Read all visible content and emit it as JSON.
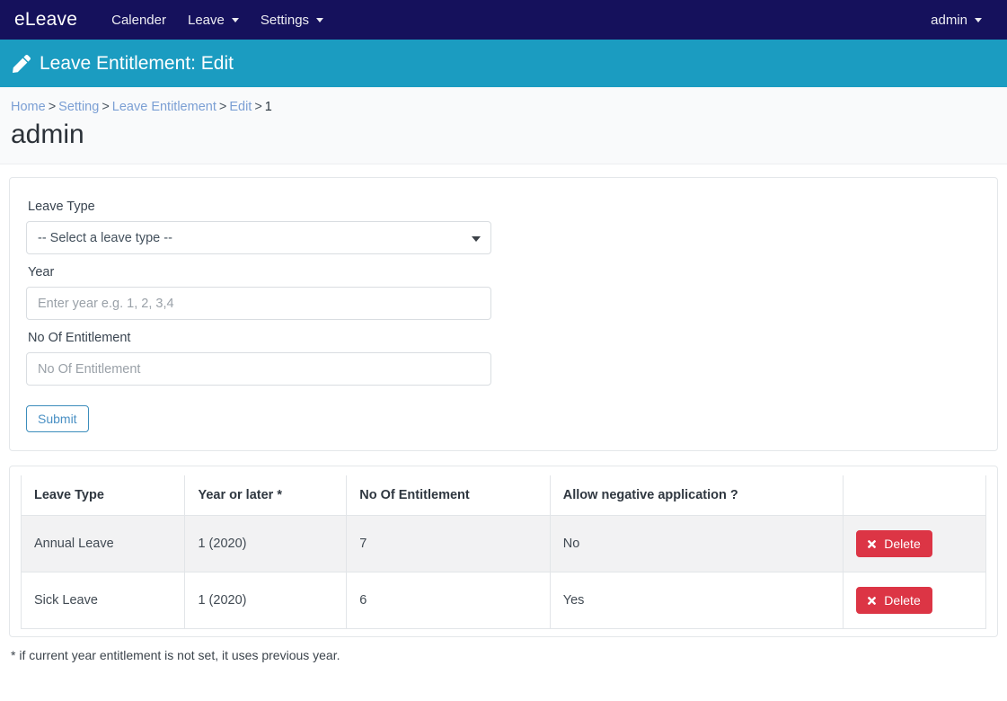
{
  "navbar": {
    "brand": "eLeave",
    "items": [
      {
        "label": "Calender",
        "has_caret": false
      },
      {
        "label": "Leave",
        "has_caret": true
      },
      {
        "label": "Settings",
        "has_caret": true
      }
    ],
    "user": {
      "label": "admin",
      "has_caret": true
    },
    "bg_color": "#15115c"
  },
  "page_header": {
    "icon": "pencil-icon",
    "title": "Leave Entitlement: Edit",
    "bg_color": "#1b9cc1"
  },
  "breadcrumb": {
    "items": [
      {
        "label": "Home",
        "link": true
      },
      {
        "label": "Setting",
        "link": true
      },
      {
        "label": "Leave Entitlement",
        "link": true
      },
      {
        "label": "Edit",
        "link": true
      },
      {
        "label": "1",
        "link": false
      }
    ],
    "separator": ">"
  },
  "entity_name": "admin",
  "form": {
    "leave_type": {
      "label": "Leave Type",
      "selected": "-- Select a leave type --",
      "options": [
        "-- Select a leave type --"
      ]
    },
    "year": {
      "label": "Year",
      "value": "",
      "placeholder": "Enter year e.g. 1, 2, 3,4"
    },
    "no_of_entitlement": {
      "label": "No Of Entitlement",
      "value": "",
      "placeholder": "No Of Entitlement"
    },
    "submit_label": "Submit"
  },
  "table": {
    "headers": [
      "Leave Type",
      "Year or later *",
      "No Of Entitlement",
      "Allow negative application ?",
      ""
    ],
    "rows": [
      {
        "leave_type": "Annual Leave",
        "year": "1 (2020)",
        "entitlement": "7",
        "allow_negative": "No",
        "action_label": "Delete"
      },
      {
        "leave_type": "Sick Leave",
        "year": "1 (2020)",
        "entitlement": "6",
        "allow_negative": "Yes",
        "action_label": "Delete"
      }
    ],
    "delete_color": "#dc3545"
  },
  "footnote": "* if current year entitlement is not set, it uses previous year."
}
